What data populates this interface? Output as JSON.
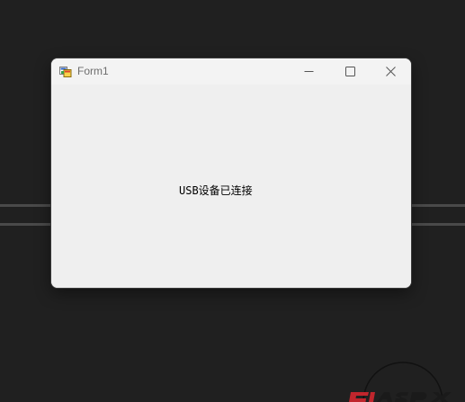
{
  "window": {
    "title": "Form1",
    "icon": "winforms-app-icon"
  },
  "title_controls": {
    "minimize_icon": "minimize-icon",
    "maximize_icon": "maximize-icon",
    "close_icon": "close-icon"
  },
  "client": {
    "status_text": "USB设备已连接"
  },
  "watermark": {
    "logo": "watermark-logo"
  },
  "colors": {
    "desktop_bg": "#202020",
    "window_bg": "#efefef",
    "title_text": "#6d6d6d",
    "watermark_red": "#c0262d"
  }
}
